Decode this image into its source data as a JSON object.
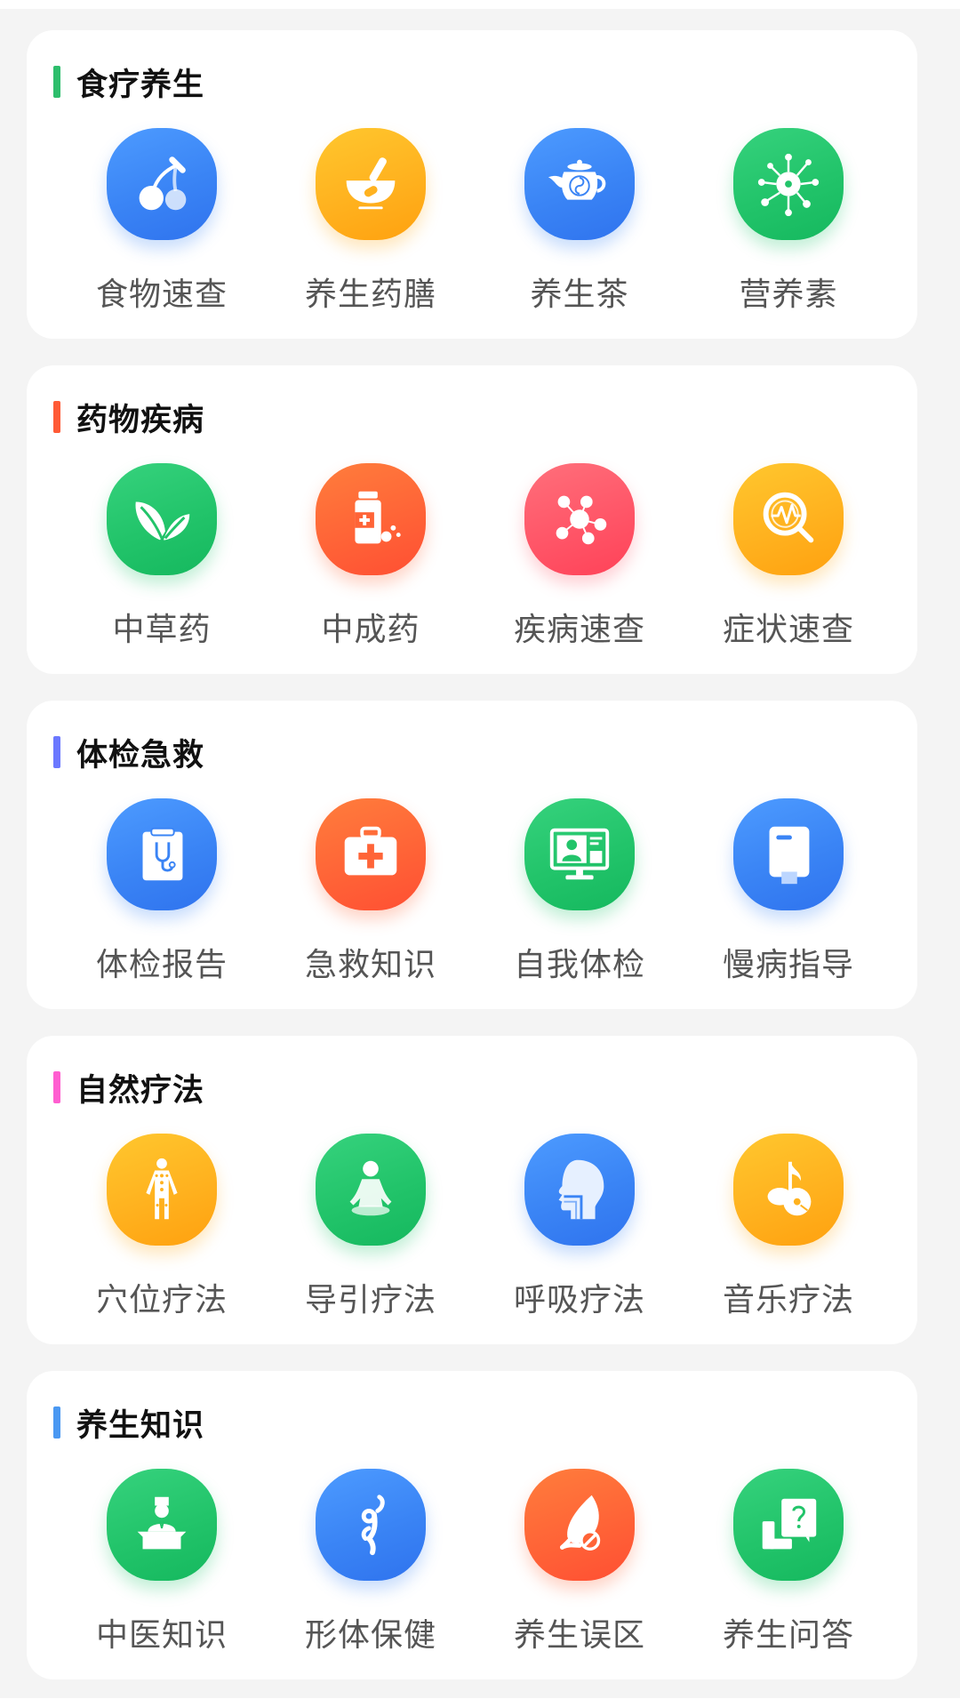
{
  "sections": [
    {
      "title": "食疗养生",
      "accent": "#2dbe6c",
      "items": [
        {
          "label": "食物速查",
          "icon": "cherry-icon",
          "color": "blue"
        },
        {
          "label": "养生药膳",
          "icon": "mortar-bowl-icon",
          "color": "yellow"
        },
        {
          "label": "养生茶",
          "icon": "teapot-icon",
          "color": "blue"
        },
        {
          "label": "营养素",
          "icon": "molecule-icon",
          "color": "green"
        }
      ]
    },
    {
      "title": "药物疾病",
      "accent": "#ff5a36",
      "items": [
        {
          "label": "中草药",
          "icon": "leaves-icon",
          "color": "green"
        },
        {
          "label": "中成药",
          "icon": "medicine-bottle-icon",
          "color": "orange"
        },
        {
          "label": "疾病速查",
          "icon": "network-icon",
          "color": "red"
        },
        {
          "label": "症状速查",
          "icon": "pulse-search-icon",
          "color": "yellow"
        }
      ]
    },
    {
      "title": "体检急救",
      "accent": "#6b78ff",
      "items": [
        {
          "label": "体检报告",
          "icon": "clipboard-stethoscope-icon",
          "color": "blue"
        },
        {
          "label": "急救知识",
          "icon": "first-aid-kit-icon",
          "color": "orange"
        },
        {
          "label": "自我体检",
          "icon": "monitor-user-icon",
          "color": "green"
        },
        {
          "label": "慢病指导",
          "icon": "book-icon",
          "color": "blue"
        }
      ]
    },
    {
      "title": "自然疗法",
      "accent": "#ff5ed0",
      "items": [
        {
          "label": "穴位疗法",
          "icon": "acupoint-body-icon",
          "color": "yellow"
        },
        {
          "label": "导引疗法",
          "icon": "meditation-icon",
          "color": "green"
        },
        {
          "label": "呼吸疗法",
          "icon": "head-airway-icon",
          "color": "blue"
        },
        {
          "label": "音乐疗法",
          "icon": "music-disc-icon",
          "color": "yellow"
        }
      ]
    },
    {
      "title": "养生知识",
      "accent": "#4a98f2",
      "items": [
        {
          "label": "中医知识",
          "icon": "doctor-podium-icon",
          "color": "green"
        },
        {
          "label": "形体保健",
          "icon": "dancer-icon",
          "color": "blue"
        },
        {
          "label": "养生误区",
          "icon": "leaf-forbidden-icon",
          "color": "orange"
        },
        {
          "label": "养生问答",
          "icon": "question-chat-icon",
          "color": "green"
        }
      ]
    }
  ]
}
